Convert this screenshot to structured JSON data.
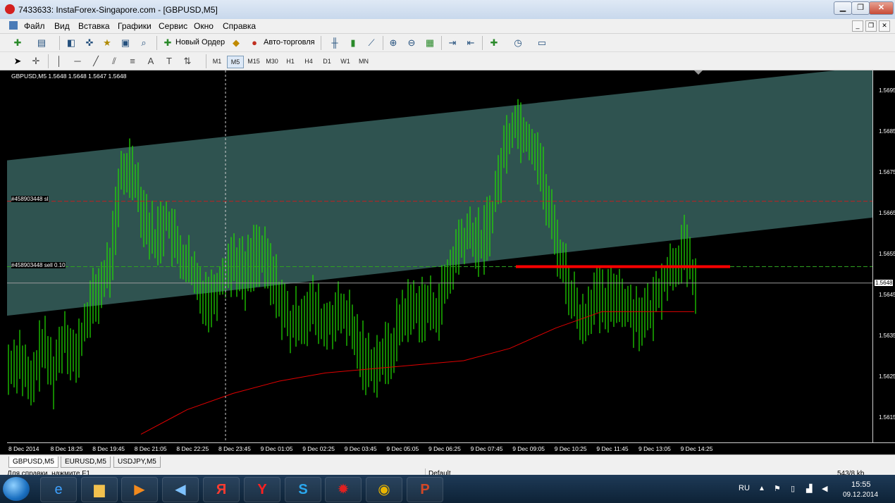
{
  "window": {
    "title": "7433633: InstaForex-Singapore.com - [GBPUSD,M5]",
    "minimize": "▁",
    "maximize": "❐",
    "close": "✕"
  },
  "menu": {
    "items": [
      "Файл",
      "Вид",
      "Вставка",
      "Графики",
      "Сервис",
      "Окно",
      "Справка"
    ]
  },
  "toolbar": {
    "new_order": "Новый Ордер",
    "auto_trading": "Авто-торговля",
    "timeframes": [
      "M1",
      "M5",
      "M15",
      "M30",
      "H1",
      "H4",
      "D1",
      "W1",
      "MN"
    ],
    "active_timeframe": "M5"
  },
  "chart": {
    "header": "GBPUSD,M5  1.5648 1.5648 1.5647 1.5648",
    "current_price": "1.5648",
    "sl_label": "#458903448 sl",
    "order_label": "#458903448 sell 0.10",
    "colors": {
      "background": "#000000",
      "channel": "#2f5350",
      "candles": "#22e000",
      "moving_average": "#e00000",
      "order_line": "#ff0000"
    }
  },
  "chart_data": {
    "type": "line",
    "symbol": "GBPUSD",
    "timeframe": "M5",
    "price_ticks": [
      1.5695,
      1.5685,
      1.5675,
      1.5665,
      1.5655,
      1.5645,
      1.5635,
      1.5625,
      1.5615
    ],
    "price_tick_labels": [
      "1.5695",
      "1.5685",
      "1.5675",
      "1.5665",
      "1.5655",
      "1.5645",
      "1.5635",
      "1.5625",
      "1.5615"
    ],
    "ylim": [
      1.5609,
      1.57
    ],
    "time_labels": [
      "8 Dec 2014",
      "8 Dec 18:25",
      "8 Dec 19:45",
      "8 Dec 21:05",
      "8 Dec 22:25",
      "8 Dec 23:45",
      "9 Dec 01:05",
      "9 Dec 02:25",
      "9 Dec 03:45",
      "9 Dec 05:05",
      "9 Dec 06:25",
      "9 Dec 07:45",
      "9 Dec 09:05",
      "9 Dec 10:25",
      "9 Dec 11:45",
      "9 Dec 13:05",
      "9 Dec 14:25"
    ],
    "price_path": [
      1.5627,
      1.563,
      1.5622,
      1.5633,
      1.5626,
      1.5636,
      1.5629,
      1.564,
      1.5646,
      1.5652,
      1.5674,
      1.5677,
      1.5665,
      1.5658,
      1.5664,
      1.5656,
      1.5652,
      1.5646,
      1.5644,
      1.565,
      1.5654,
      1.565,
      1.5656,
      1.5652,
      1.5645,
      1.5637,
      1.564,
      1.5642,
      1.5637,
      1.564,
      1.564,
      1.5633,
      1.5628,
      1.5629,
      1.5631,
      1.564,
      1.5642,
      1.5642,
      1.5641,
      1.5648,
      1.5657,
      1.566,
      1.5657,
      1.5665,
      1.568,
      1.5688,
      1.5684,
      1.568,
      1.5666,
      1.5655,
      1.5645,
      1.5638,
      1.5645,
      1.5642,
      1.5646,
      1.5642,
      1.564,
      1.564,
      1.5648,
      1.5652,
      1.5656,
      1.5648
    ],
    "moving_average": [
      1.5611,
      1.5617,
      1.5621,
      1.5624,
      1.5626,
      1.5627,
      1.5628,
      1.5629,
      1.5632,
      1.5637,
      1.5641,
      1.5641,
      1.5641
    ],
    "channel_upper": [
      1.5678,
      1.5701
    ],
    "channel_lower": [
      1.564,
      1.5664
    ],
    "current_price": 1.5648,
    "stop_loss": 1.5668,
    "sell_order": 1.5652
  },
  "tabs": {
    "items": [
      "GBPUSD,M5",
      "EURUSD,M5",
      "USDJPY,M5"
    ],
    "active": "GBPUSD,M5"
  },
  "status": {
    "help": "Для справки, нажмите F1",
    "profile": "Default",
    "traffic": "543/8 kb"
  },
  "taskbar": {
    "lang": "RU",
    "time": "15:55",
    "date": "09.12.2014",
    "apps": [
      "ie-icon",
      "explorer-icon",
      "media-player-icon",
      "sound-icon",
      "yandex-icon",
      "yandex-browser-icon",
      "skype-icon",
      "instaforex-icon",
      "chrome-icon",
      "powerpoint-icon"
    ]
  }
}
